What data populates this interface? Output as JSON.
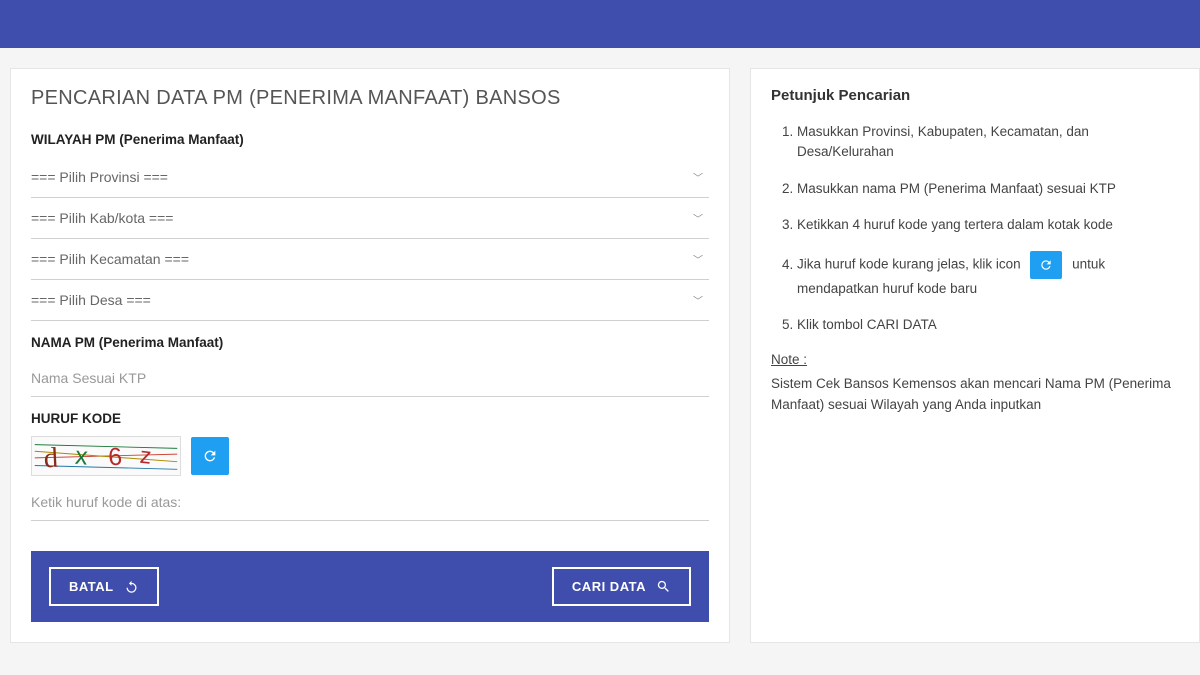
{
  "main": {
    "title": "PENCARIAN DATA PM (PENERIMA MANFAAT) BANSOS",
    "wilayah_label": "WILAYAH PM (Penerima Manfaat)",
    "selects": {
      "provinsi": "=== Pilih Provinsi ===",
      "kabkota": "=== Pilih Kab/kota ===",
      "kecamatan": "=== Pilih Kecamatan ===",
      "desa": "=== Pilih Desa ==="
    },
    "nama_label": "NAMA PM (Penerima Manfaat)",
    "nama_placeholder": "Nama Sesuai KTP",
    "kode_label": "HURUF KODE",
    "kode_placeholder": "Ketik huruf kode di atas:",
    "captcha_value": "dx6z",
    "batal_label": "BATAL",
    "cari_label": "CARI DATA"
  },
  "side": {
    "title": "Petunjuk Pencarian",
    "items": [
      "Masukkan Provinsi, Kabupaten, Kecamatan, dan Desa/Kelurahan",
      "Masukkan nama PM (Penerima Manfaat) sesuai KTP",
      "Ketikkan 4 huruf kode yang tertera dalam kotak kode",
      "",
      "Klik tombol CARI DATA"
    ],
    "item4_prefix": "Jika huruf kode kurang jelas, klik icon",
    "item4_suffix": "untuk mendapatkan huruf kode baru",
    "note_label": "Note :",
    "note_text": "Sistem Cek Bansos Kemensos akan mencari Nama PM (Penerima Manfaat) sesuai Wilayah yang Anda inputkan"
  }
}
